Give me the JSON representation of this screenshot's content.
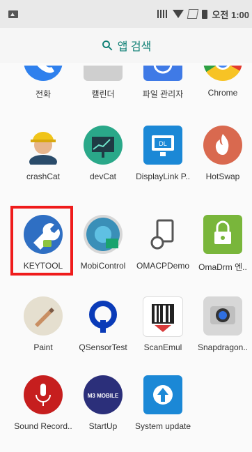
{
  "status_bar": {
    "time": "오전 1:00"
  },
  "search": {
    "label": "앱 검색"
  },
  "apps": [
    {
      "label": "전화"
    },
    {
      "label": "캘린더"
    },
    {
      "label": "파일 관리자"
    },
    {
      "label": "Chrome"
    },
    {
      "label": "crashCat"
    },
    {
      "label": "devCat"
    },
    {
      "label": "DisplayLink P.."
    },
    {
      "label": "HotSwap"
    },
    {
      "label": "KEYTOOL"
    },
    {
      "label": "MobiControl"
    },
    {
      "label": "OMACPDemo"
    },
    {
      "label": "OmaDrm 엔.."
    },
    {
      "label": "Paint"
    },
    {
      "label": "QSensorTest"
    },
    {
      "label": "ScanEmul"
    },
    {
      "label": "Snapdragon.."
    },
    {
      "label": "Sound Record.."
    },
    {
      "label": "StartUp"
    },
    {
      "label": "System update"
    }
  ],
  "icons": {
    "displaylink_text": "DL",
    "m3_text": "M3 MOBILE"
  }
}
